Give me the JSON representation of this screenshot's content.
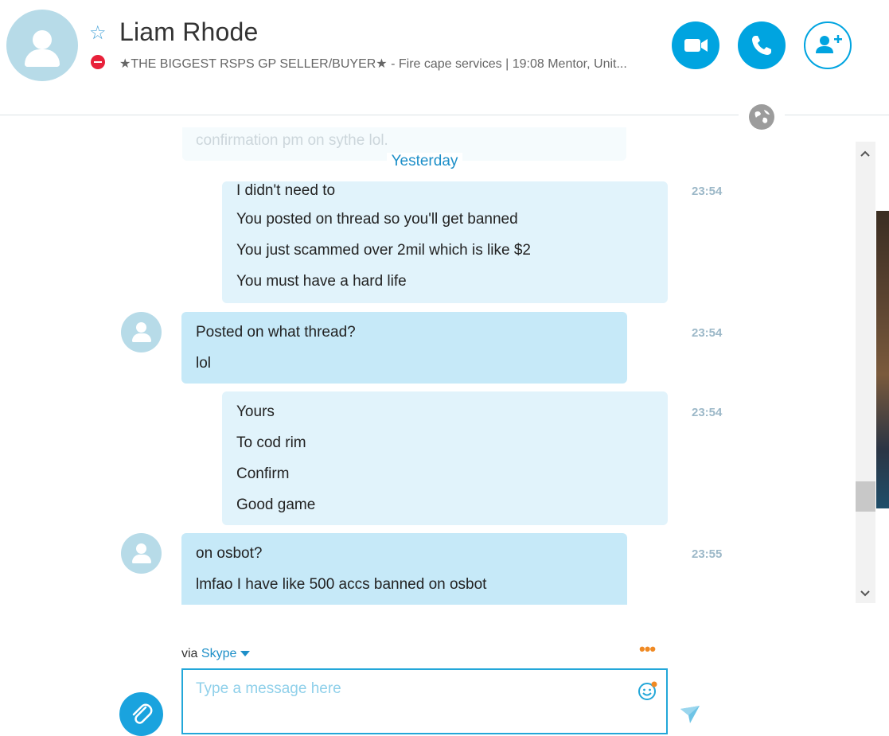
{
  "header": {
    "contact_name": "Liam Rhode",
    "mood": "★THE BIGGEST RSPS GP SELLER/BUYER★ - Fire cape services  |  19:08 Mentor, Unit...",
    "status": "do-not-disturb",
    "buttons": {
      "video": "video-call",
      "call": "audio-call",
      "add": "add-people"
    }
  },
  "chat": {
    "faded_text": "confirmation pm on sythe lol.",
    "day_separator": "Yesterday",
    "messages": [
      {
        "from": "me",
        "time": "23:54",
        "lines": [
          "I didn't need to",
          "You posted on thread so you'll get banned",
          "You just scammed over 2mil which is like $2",
          "You must have a hard life"
        ]
      },
      {
        "from": "contact",
        "time": "23:54",
        "lines": [
          "Posted on what thread?",
          "lol"
        ]
      },
      {
        "from": "me",
        "time": "23:54",
        "lines": [
          "Yours",
          "To cod rim",
          "Confirm",
          "Good game"
        ]
      },
      {
        "from": "contact",
        "time": "23:55",
        "lines": [
          "on osbot?",
          "lmfao I have like 500 accs banned on osbot"
        ]
      }
    ]
  },
  "composer": {
    "via_label": "via",
    "via_service": "Skype",
    "placeholder": "Type a message here",
    "more": "•••"
  },
  "colors": {
    "accent": "#00a4e0",
    "own_bubble": "#e1f3fb",
    "other_bubble": "#c6e9f8",
    "status_dnd": "#e8213a"
  }
}
